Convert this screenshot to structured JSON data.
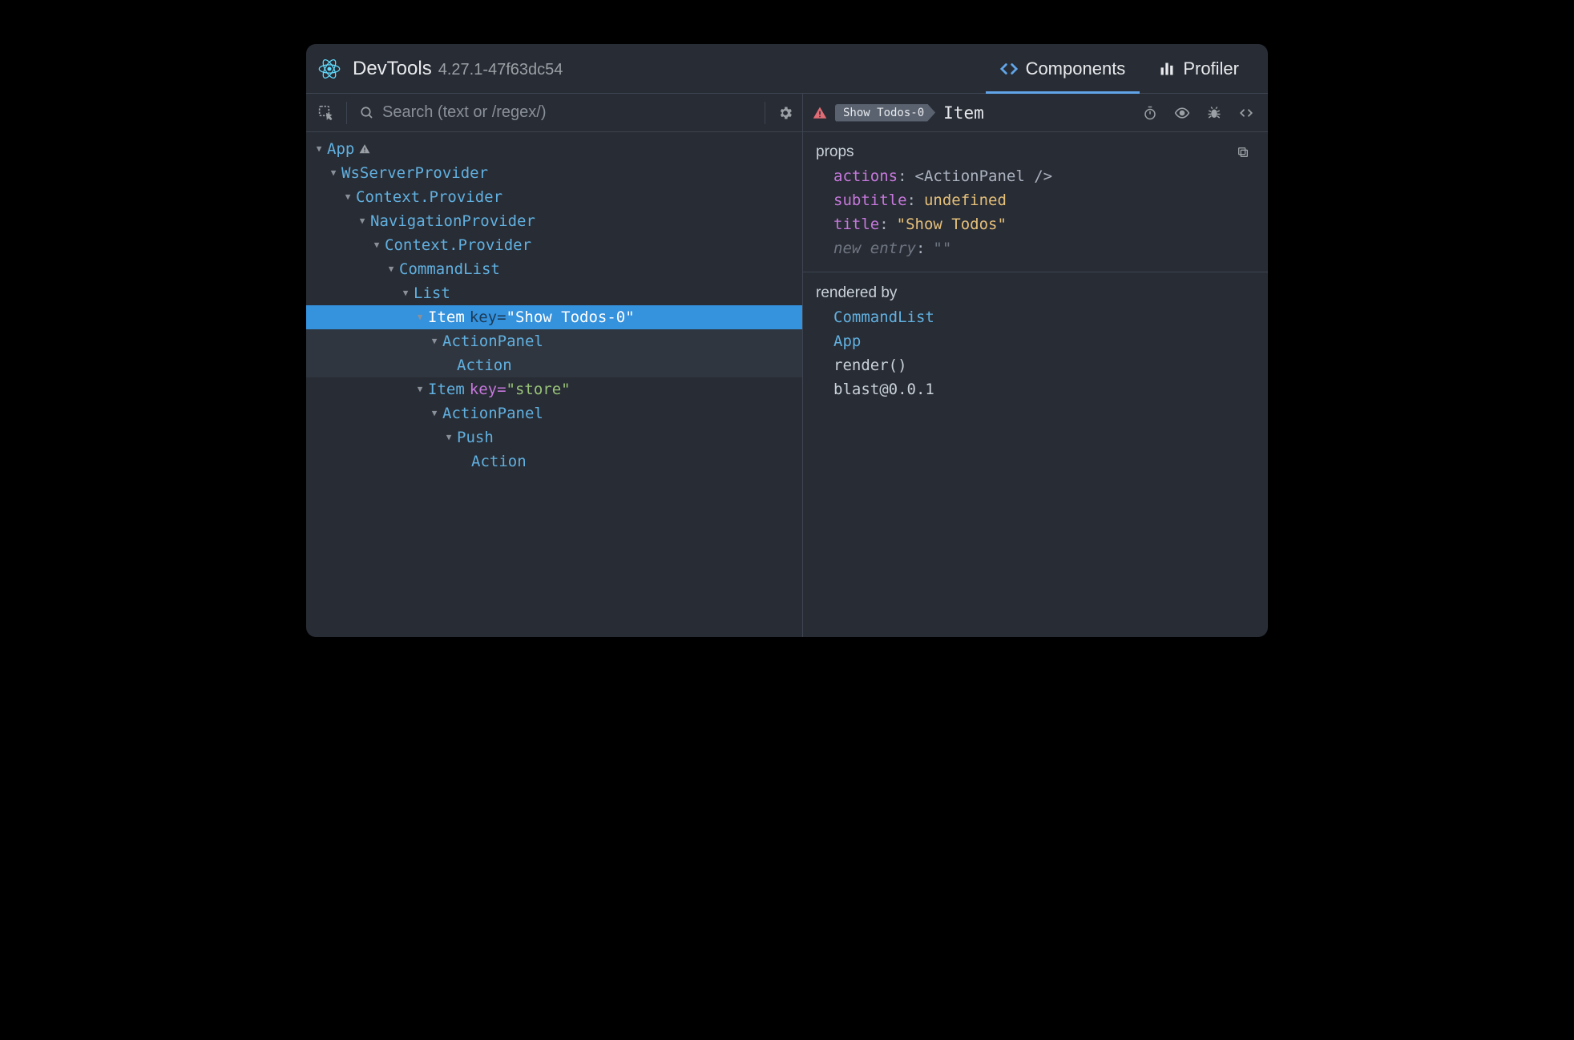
{
  "header": {
    "app_name": "DevTools",
    "version": "4.27.1-47f63dc54",
    "tabs": [
      {
        "label": "Components",
        "active": true
      },
      {
        "label": "Profiler",
        "active": false
      }
    ]
  },
  "toolbar": {
    "search_placeholder": "Search (text or /regex/)"
  },
  "tree": [
    {
      "depth": 0,
      "name": "App",
      "warn": true
    },
    {
      "depth": 1,
      "name": "WsServerProvider"
    },
    {
      "depth": 2,
      "name": "Context.Provider"
    },
    {
      "depth": 3,
      "name": "NavigationProvider"
    },
    {
      "depth": 4,
      "name": "Context.Provider"
    },
    {
      "depth": 5,
      "name": "CommandList"
    },
    {
      "depth": 6,
      "name": "List"
    },
    {
      "depth": 7,
      "name": "Item",
      "keyAttr": "\"Show Todos-0\"",
      "selected": true
    },
    {
      "depth": 8,
      "name": "ActionPanel",
      "dim": true
    },
    {
      "depth": 9,
      "name": "Action",
      "noCaret": true,
      "dim": true
    },
    {
      "depth": 7,
      "name": "Item",
      "keyAttr": "\"store\""
    },
    {
      "depth": 8,
      "name": "ActionPanel"
    },
    {
      "depth": 9,
      "name": "Push"
    },
    {
      "depth": 10,
      "name": "Action",
      "noCaret": true
    }
  ],
  "selected": {
    "pill": "Show Todos-0",
    "component": "Item"
  },
  "props": {
    "section_title": "props",
    "rows": [
      {
        "key": "actions",
        "type": "node",
        "value": "<ActionPanel />"
      },
      {
        "key": "subtitle",
        "type": "undef",
        "value": "undefined"
      },
      {
        "key": "title",
        "type": "str",
        "value": "\"Show Todos\""
      }
    ],
    "new_entry_label": "new entry",
    "new_entry_value": "\"\""
  },
  "rendered_by": {
    "section_title": "rendered by",
    "items": [
      {
        "label": "CommandList",
        "link": true
      },
      {
        "label": "App",
        "link": true
      },
      {
        "label": "render()",
        "link": false
      },
      {
        "label": "blast@0.0.1",
        "link": false
      }
    ]
  }
}
